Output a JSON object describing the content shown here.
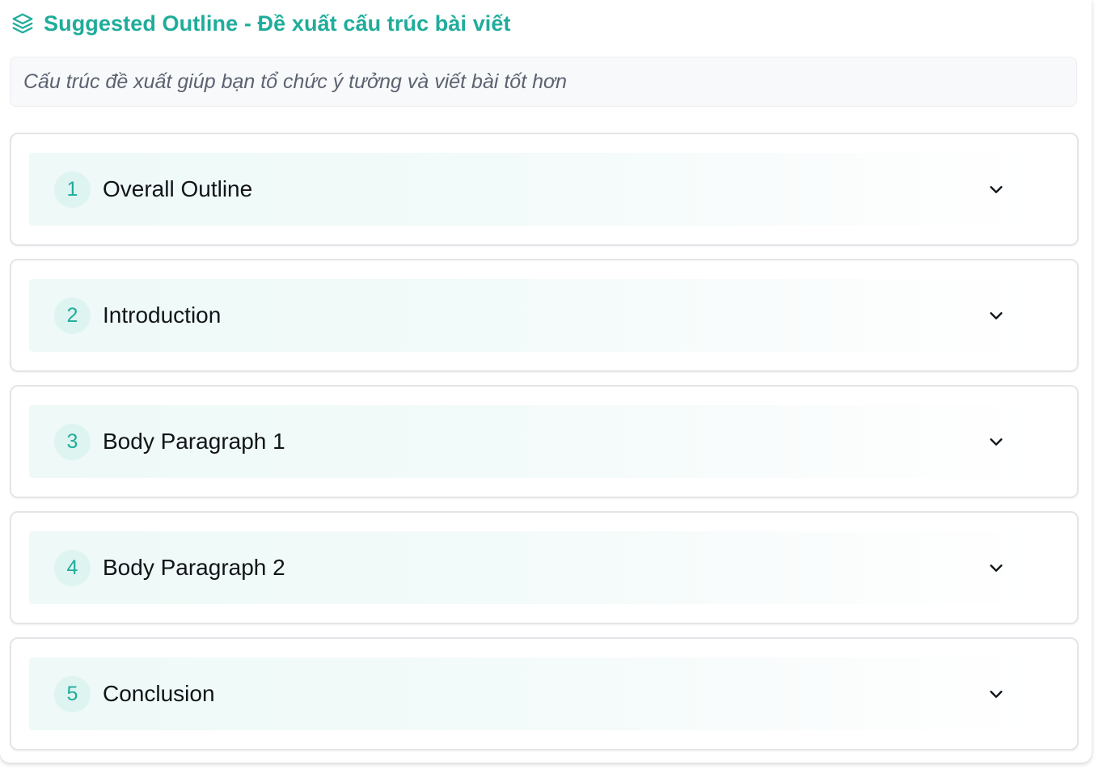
{
  "header": {
    "title": "Suggested Outline - Đề xuất cấu trúc bài viết",
    "icon": "layers-icon",
    "accent_color": "#1fac9b"
  },
  "note": {
    "text": "Cấu trúc đề xuất giúp bạn tổ chức ý tưởng và viết bài tốt hơn"
  },
  "sections": [
    {
      "number": "1",
      "title": "Overall Outline",
      "icon": "chevron-down-icon"
    },
    {
      "number": "2",
      "title": "Introduction",
      "icon": "chevron-down-icon"
    },
    {
      "number": "3",
      "title": "Body Paragraph 1",
      "icon": "chevron-down-icon"
    },
    {
      "number": "4",
      "title": "Body Paragraph 2",
      "icon": "chevron-down-icon"
    },
    {
      "number": "5",
      "title": "Conclusion",
      "icon": "chevron-down-icon"
    }
  ]
}
